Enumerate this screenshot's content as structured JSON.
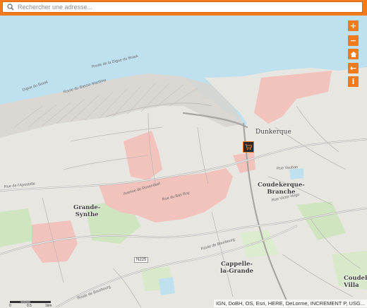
{
  "search": {
    "placeholder": "Rechercher une adresse..."
  },
  "tools": {
    "zoom_in": "+",
    "zoom_out": "−",
    "home": "⌂",
    "back": "←",
    "info": "i"
  },
  "places": {
    "dunkerque": "Dunkerque",
    "coudekerque_branche": "Coudekerque-\nBranche",
    "grande_synthe": "Grande-\nSynthe",
    "cappelle": "Cappelle-\nla-Grande",
    "coudekerque_village": "Coudeke\nVilla"
  },
  "roads": {
    "digue_braek": "Route de la Digue du Braek",
    "digue_braek2": "Digue du Braek",
    "bassin_maritime": "Route du Bassin Maritime",
    "rue_lapostolle": "Rue de l'Apostolle",
    "rue_bas_roy": "Rue du Bas Roy",
    "avenue_rosendael": "Avenue de Rosendael",
    "n225": "N225",
    "rue_vauban": "Rue Vauban",
    "rue_victor_hugo": "Rue Victor Hugo",
    "route_bourbourg": "Route de Bourbourg",
    "a16": "Autoroute"
  },
  "scale": {
    "zero": "0",
    "mid": "0.5",
    "end": "1km"
  },
  "attribution": "IGN, DoBH, OS, Esri, HERE, DeLorme, INCREMENT P, USG...",
  "colors": {
    "accent": "#f07a1c",
    "sea": "#bfe0ef",
    "urban": "#f2c2bd",
    "land": "#e8e6e1",
    "park": "#cfe5c0"
  }
}
